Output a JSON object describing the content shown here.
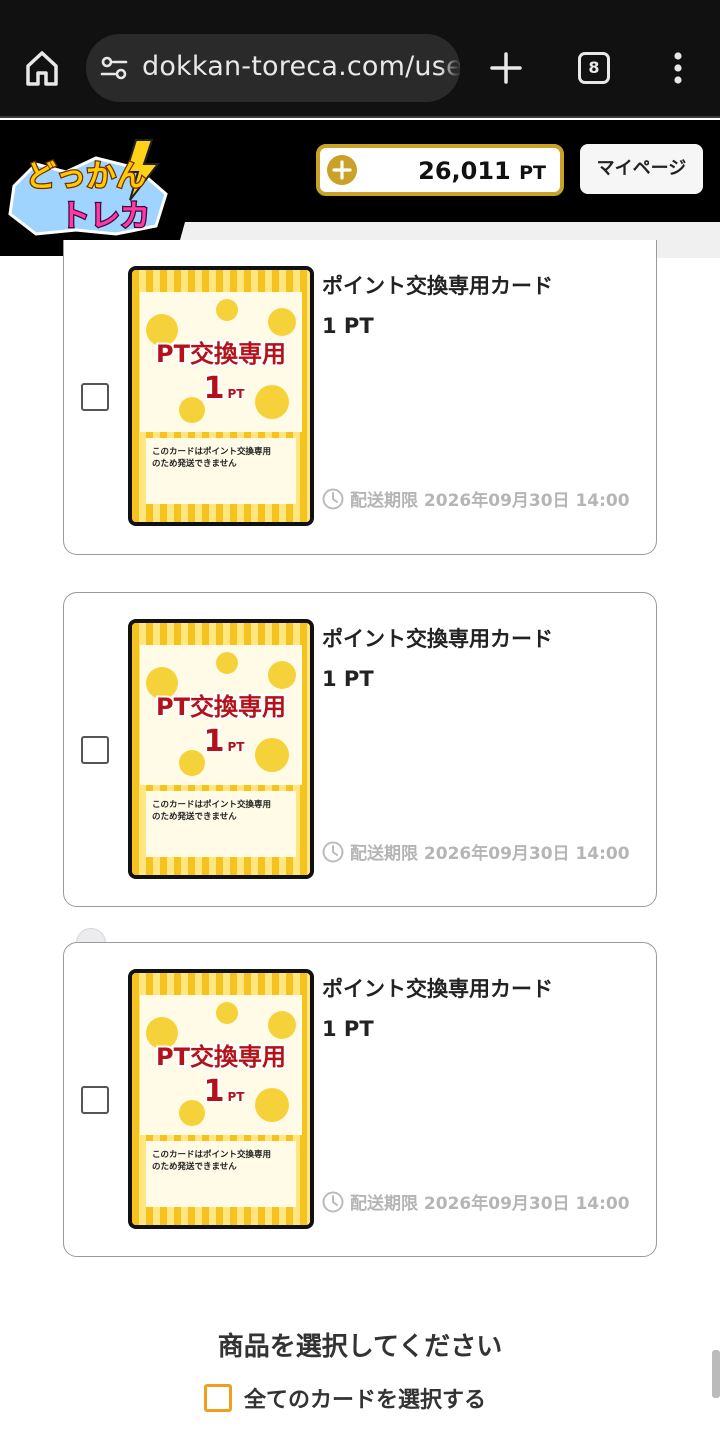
{
  "browser": {
    "url": "dokkan-toreca.com/user",
    "tab_count": "8",
    "icons": [
      "home-icon",
      "site-settings-icon",
      "new-tab-plus-icon",
      "tab-switcher-icon",
      "more-menu-icon"
    ]
  },
  "header": {
    "logo_text": "どっかん!トレカ",
    "points_value": "26,011",
    "points_unit": "PT",
    "mypage_label": "マイページ"
  },
  "card_art": {
    "title": "PT交換専用",
    "value": "1",
    "unit": "PT",
    "note_line1": "このカードはポイント交換専用",
    "note_line2": "のため発送できません"
  },
  "items": [
    {
      "name": "ポイント交換専用カード",
      "price": "1 PT",
      "deadline_label": "配送期限",
      "deadline": "2026年09月30日 14:00",
      "checked": false
    },
    {
      "name": "ポイント交換専用カード",
      "price": "1 PT",
      "deadline_label": "配送期限",
      "deadline": "2026年09月30日 14:00",
      "checked": false
    },
    {
      "name": "ポイント交換専用カード",
      "price": "1 PT",
      "deadline_label": "配送期限",
      "deadline": "2026年09月30日 14:00",
      "checked": false
    }
  ],
  "footer": {
    "prompt": "商品を選択してください",
    "select_all_label": "全てのカードを選択する"
  },
  "colors": {
    "accent_gold": "#c9a227",
    "select_all_orange": "#f0a020",
    "card_red": "#b3121b",
    "card_yellow": "#f6d23a"
  }
}
